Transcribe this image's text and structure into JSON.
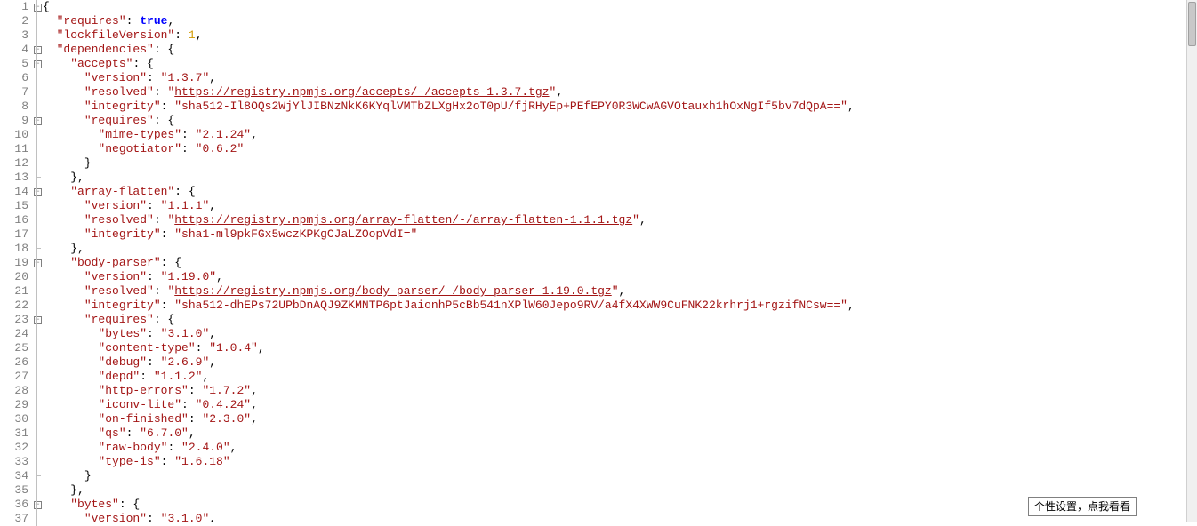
{
  "tooltip": {
    "text": "个性设置，点我看看"
  },
  "lines": [
    {
      "n": 1,
      "fold": "box",
      "ind": 0,
      "tokens": [
        {
          "t": "punc",
          "v": "{"
        }
      ]
    },
    {
      "n": 2,
      "fold": "bar",
      "ind": 1,
      "tokens": [
        {
          "t": "key",
          "v": "\"requires\""
        },
        {
          "t": "punc",
          "v": ": "
        },
        {
          "t": "bool",
          "v": "true"
        },
        {
          "t": "punc",
          "v": ","
        }
      ]
    },
    {
      "n": 3,
      "fold": "bar",
      "ind": 1,
      "tokens": [
        {
          "t": "key",
          "v": "\"lockfileVersion\""
        },
        {
          "t": "punc",
          "v": ": "
        },
        {
          "t": "num",
          "v": "1"
        },
        {
          "t": "punc",
          "v": ","
        }
      ]
    },
    {
      "n": 4,
      "fold": "box",
      "ind": 1,
      "tokens": [
        {
          "t": "key",
          "v": "\"dependencies\""
        },
        {
          "t": "punc",
          "v": ": {"
        }
      ]
    },
    {
      "n": 5,
      "fold": "box",
      "ind": 2,
      "tokens": [
        {
          "t": "key",
          "v": "\"accepts\""
        },
        {
          "t": "punc",
          "v": ": {"
        }
      ]
    },
    {
      "n": 6,
      "fold": "bar",
      "ind": 3,
      "tokens": [
        {
          "t": "key",
          "v": "\"version\""
        },
        {
          "t": "punc",
          "v": ": "
        },
        {
          "t": "str",
          "v": "\"1.3.7\""
        },
        {
          "t": "punc",
          "v": ","
        }
      ]
    },
    {
      "n": 7,
      "fold": "bar",
      "ind": 3,
      "tokens": [
        {
          "t": "key",
          "v": "\"resolved\""
        },
        {
          "t": "punc",
          "v": ": "
        },
        {
          "t": "str",
          "v": "\""
        },
        {
          "t": "link",
          "v": "https://registry.npmjs.org/accepts/-/accepts-1.3.7.tgz"
        },
        {
          "t": "str",
          "v": "\""
        },
        {
          "t": "punc",
          "v": ","
        }
      ]
    },
    {
      "n": 8,
      "fold": "bar",
      "ind": 3,
      "tokens": [
        {
          "t": "key",
          "v": "\"integrity\""
        },
        {
          "t": "punc",
          "v": ": "
        },
        {
          "t": "str",
          "v": "\"sha512-Il8OQs2WjYlJIBNzNkK6KYqlVMTbZLXgHx2oT0pU/fjRHyEp+PEfEPY0R3WCwAGVOtauxh1hOxNgIf5bv7dQpA==\""
        },
        {
          "t": "punc",
          "v": ","
        }
      ]
    },
    {
      "n": 9,
      "fold": "box",
      "ind": 3,
      "tokens": [
        {
          "t": "key",
          "v": "\"requires\""
        },
        {
          "t": "punc",
          "v": ": {"
        }
      ]
    },
    {
      "n": 10,
      "fold": "bar",
      "ind": 4,
      "tokens": [
        {
          "t": "key",
          "v": "\"mime-types\""
        },
        {
          "t": "punc",
          "v": ": "
        },
        {
          "t": "str",
          "v": "\"2.1.24\""
        },
        {
          "t": "punc",
          "v": ","
        }
      ]
    },
    {
      "n": 11,
      "fold": "bar",
      "ind": 4,
      "tokens": [
        {
          "t": "key",
          "v": "\"negotiator\""
        },
        {
          "t": "punc",
          "v": ": "
        },
        {
          "t": "str",
          "v": "\"0.6.2\""
        }
      ]
    },
    {
      "n": 12,
      "fold": "end",
      "ind": 3,
      "tokens": [
        {
          "t": "punc",
          "v": "}"
        }
      ]
    },
    {
      "n": 13,
      "fold": "end",
      "ind": 2,
      "tokens": [
        {
          "t": "punc",
          "v": "},"
        }
      ]
    },
    {
      "n": 14,
      "fold": "box",
      "ind": 2,
      "tokens": [
        {
          "t": "key",
          "v": "\"array-flatten\""
        },
        {
          "t": "punc",
          "v": ": {"
        }
      ]
    },
    {
      "n": 15,
      "fold": "bar",
      "ind": 3,
      "tokens": [
        {
          "t": "key",
          "v": "\"version\""
        },
        {
          "t": "punc",
          "v": ": "
        },
        {
          "t": "str",
          "v": "\"1.1.1\""
        },
        {
          "t": "punc",
          "v": ","
        }
      ]
    },
    {
      "n": 16,
      "fold": "bar",
      "ind": 3,
      "tokens": [
        {
          "t": "key",
          "v": "\"resolved\""
        },
        {
          "t": "punc",
          "v": ": "
        },
        {
          "t": "str",
          "v": "\""
        },
        {
          "t": "link",
          "v": "https://registry.npmjs.org/array-flatten/-/array-flatten-1.1.1.tgz"
        },
        {
          "t": "str",
          "v": "\""
        },
        {
          "t": "punc",
          "v": ","
        }
      ]
    },
    {
      "n": 17,
      "fold": "bar",
      "ind": 3,
      "tokens": [
        {
          "t": "key",
          "v": "\"integrity\""
        },
        {
          "t": "punc",
          "v": ": "
        },
        {
          "t": "str",
          "v": "\"sha1-ml9pkFGx5wczKPKgCJaLZOopVdI=\""
        }
      ]
    },
    {
      "n": 18,
      "fold": "end",
      "ind": 2,
      "tokens": [
        {
          "t": "punc",
          "v": "},"
        }
      ]
    },
    {
      "n": 19,
      "fold": "box",
      "ind": 2,
      "tokens": [
        {
          "t": "key",
          "v": "\"body-parser\""
        },
        {
          "t": "punc",
          "v": ": {"
        }
      ]
    },
    {
      "n": 20,
      "fold": "bar",
      "ind": 3,
      "tokens": [
        {
          "t": "key",
          "v": "\"version\""
        },
        {
          "t": "punc",
          "v": ": "
        },
        {
          "t": "str",
          "v": "\"1.19.0\""
        },
        {
          "t": "punc",
          "v": ","
        }
      ]
    },
    {
      "n": 21,
      "fold": "bar",
      "ind": 3,
      "tokens": [
        {
          "t": "key",
          "v": "\"resolved\""
        },
        {
          "t": "punc",
          "v": ": "
        },
        {
          "t": "str",
          "v": "\""
        },
        {
          "t": "link",
          "v": "https://registry.npmjs.org/body-parser/-/body-parser-1.19.0.tgz"
        },
        {
          "t": "str",
          "v": "\""
        },
        {
          "t": "punc",
          "v": ","
        }
      ]
    },
    {
      "n": 22,
      "fold": "bar",
      "ind": 3,
      "tokens": [
        {
          "t": "key",
          "v": "\"integrity\""
        },
        {
          "t": "punc",
          "v": ": "
        },
        {
          "t": "str",
          "v": "\"sha512-dhEPs72UPbDnAQJ9ZKMNTP6ptJaionhP5cBb541nXPlW60Jepo9RV/a4fX4XWW9CuFNK22krhrj1+rgzifNCsw==\""
        },
        {
          "t": "punc",
          "v": ","
        }
      ]
    },
    {
      "n": 23,
      "fold": "box",
      "ind": 3,
      "tokens": [
        {
          "t": "key",
          "v": "\"requires\""
        },
        {
          "t": "punc",
          "v": ": {"
        }
      ]
    },
    {
      "n": 24,
      "fold": "bar",
      "ind": 4,
      "tokens": [
        {
          "t": "key",
          "v": "\"bytes\""
        },
        {
          "t": "punc",
          "v": ": "
        },
        {
          "t": "str",
          "v": "\"3.1.0\""
        },
        {
          "t": "punc",
          "v": ","
        }
      ]
    },
    {
      "n": 25,
      "fold": "bar",
      "ind": 4,
      "tokens": [
        {
          "t": "key",
          "v": "\"content-type\""
        },
        {
          "t": "punc",
          "v": ": "
        },
        {
          "t": "str",
          "v": "\"1.0.4\""
        },
        {
          "t": "punc",
          "v": ","
        }
      ]
    },
    {
      "n": 26,
      "fold": "bar",
      "ind": 4,
      "tokens": [
        {
          "t": "key",
          "v": "\"debug\""
        },
        {
          "t": "punc",
          "v": ": "
        },
        {
          "t": "str",
          "v": "\"2.6.9\""
        },
        {
          "t": "punc",
          "v": ","
        }
      ]
    },
    {
      "n": 27,
      "fold": "bar",
      "ind": 4,
      "tokens": [
        {
          "t": "key",
          "v": "\"depd\""
        },
        {
          "t": "punc",
          "v": ": "
        },
        {
          "t": "str",
          "v": "\"1.1.2\""
        },
        {
          "t": "punc",
          "v": ","
        }
      ]
    },
    {
      "n": 28,
      "fold": "bar",
      "ind": 4,
      "tokens": [
        {
          "t": "key",
          "v": "\"http-errors\""
        },
        {
          "t": "punc",
          "v": ": "
        },
        {
          "t": "str",
          "v": "\"1.7.2\""
        },
        {
          "t": "punc",
          "v": ","
        }
      ]
    },
    {
      "n": 29,
      "fold": "bar",
      "ind": 4,
      "tokens": [
        {
          "t": "key",
          "v": "\"iconv-lite\""
        },
        {
          "t": "punc",
          "v": ": "
        },
        {
          "t": "str",
          "v": "\"0.4.24\""
        },
        {
          "t": "punc",
          "v": ","
        }
      ]
    },
    {
      "n": 30,
      "fold": "bar",
      "ind": 4,
      "tokens": [
        {
          "t": "key",
          "v": "\"on-finished\""
        },
        {
          "t": "punc",
          "v": ": "
        },
        {
          "t": "str",
          "v": "\"2.3.0\""
        },
        {
          "t": "punc",
          "v": ","
        }
      ]
    },
    {
      "n": 31,
      "fold": "bar",
      "ind": 4,
      "tokens": [
        {
          "t": "key",
          "v": "\"qs\""
        },
        {
          "t": "punc",
          "v": ": "
        },
        {
          "t": "str",
          "v": "\"6.7.0\""
        },
        {
          "t": "punc",
          "v": ","
        }
      ]
    },
    {
      "n": 32,
      "fold": "bar",
      "ind": 4,
      "tokens": [
        {
          "t": "key",
          "v": "\"raw-body\""
        },
        {
          "t": "punc",
          "v": ": "
        },
        {
          "t": "str",
          "v": "\"2.4.0\""
        },
        {
          "t": "punc",
          "v": ","
        }
      ]
    },
    {
      "n": 33,
      "fold": "bar",
      "ind": 4,
      "tokens": [
        {
          "t": "key",
          "v": "\"type-is\""
        },
        {
          "t": "punc",
          "v": ": "
        },
        {
          "t": "str",
          "v": "\"1.6.18\""
        }
      ]
    },
    {
      "n": 34,
      "fold": "end",
      "ind": 3,
      "tokens": [
        {
          "t": "punc",
          "v": "}"
        }
      ]
    },
    {
      "n": 35,
      "fold": "end",
      "ind": 2,
      "tokens": [
        {
          "t": "punc",
          "v": "},"
        }
      ]
    },
    {
      "n": 36,
      "fold": "box",
      "ind": 2,
      "tokens": [
        {
          "t": "key",
          "v": "\"bytes\""
        },
        {
          "t": "punc",
          "v": ": {"
        }
      ]
    },
    {
      "n": 37,
      "fold": "bar",
      "ind": 3,
      "tokens": [
        {
          "t": "key",
          "v": "\"version\""
        },
        {
          "t": "punc",
          "v": ": "
        },
        {
          "t": "str",
          "v": "\"3.1.0\""
        },
        {
          "t": "punc",
          "v": ","
        }
      ]
    }
  ]
}
